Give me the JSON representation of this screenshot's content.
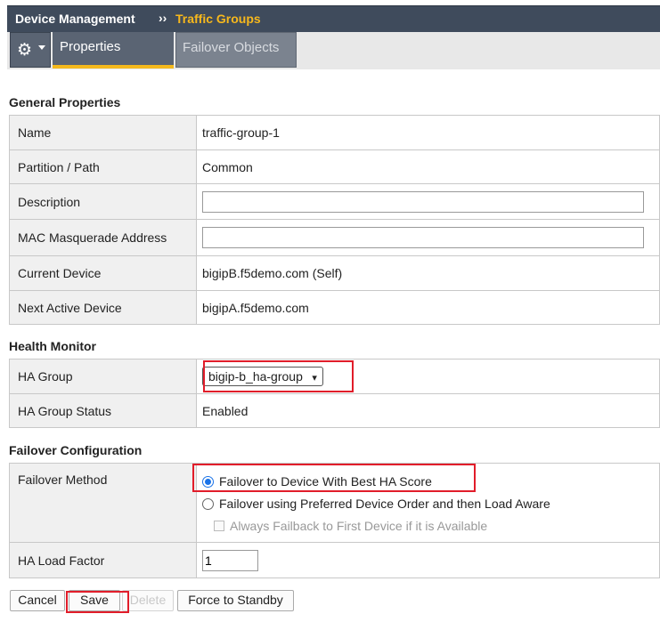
{
  "breadcrumb": {
    "section": "Device Management",
    "separator": "››",
    "current": "Traffic Groups"
  },
  "tabs": {
    "active": "Properties",
    "other": "Failover Objects"
  },
  "general": {
    "title": "General Properties",
    "name_label": "Name",
    "name_value": "traffic-group-1",
    "partition_label": "Partition / Path",
    "partition_value": "Common",
    "description_label": "Description",
    "description_value": "",
    "mac_label": "MAC Masquerade Address",
    "mac_value": "",
    "current_label": "Current Device",
    "current_value": "bigipB.f5demo.com (Self)",
    "next_label": "Next Active Device",
    "next_value": "bigipA.f5demo.com"
  },
  "health": {
    "title": "Health Monitor",
    "ha_group_label": "HA Group",
    "ha_group_value": "bigip-b_ha-group",
    "ha_status_label": "HA Group Status",
    "ha_status_value": "Enabled"
  },
  "failover": {
    "title": "Failover Configuration",
    "method_label": "Failover Method",
    "option1": "Failover to Device With Best HA Score",
    "option2": "Failover using Preferred Device Order and then Load Aware",
    "option3": "Always Failback to First Device if it is Available",
    "selected": "option1",
    "load_label": "HA Load Factor",
    "load_value": "1"
  },
  "buttons": {
    "cancel": "Cancel",
    "save": "Save",
    "delete": "Delete",
    "force": "Force to Standby"
  },
  "colors": {
    "header_bg": "#3f4b5c",
    "accent": "#f3b81c",
    "highlight_box": "#e11d2a"
  }
}
